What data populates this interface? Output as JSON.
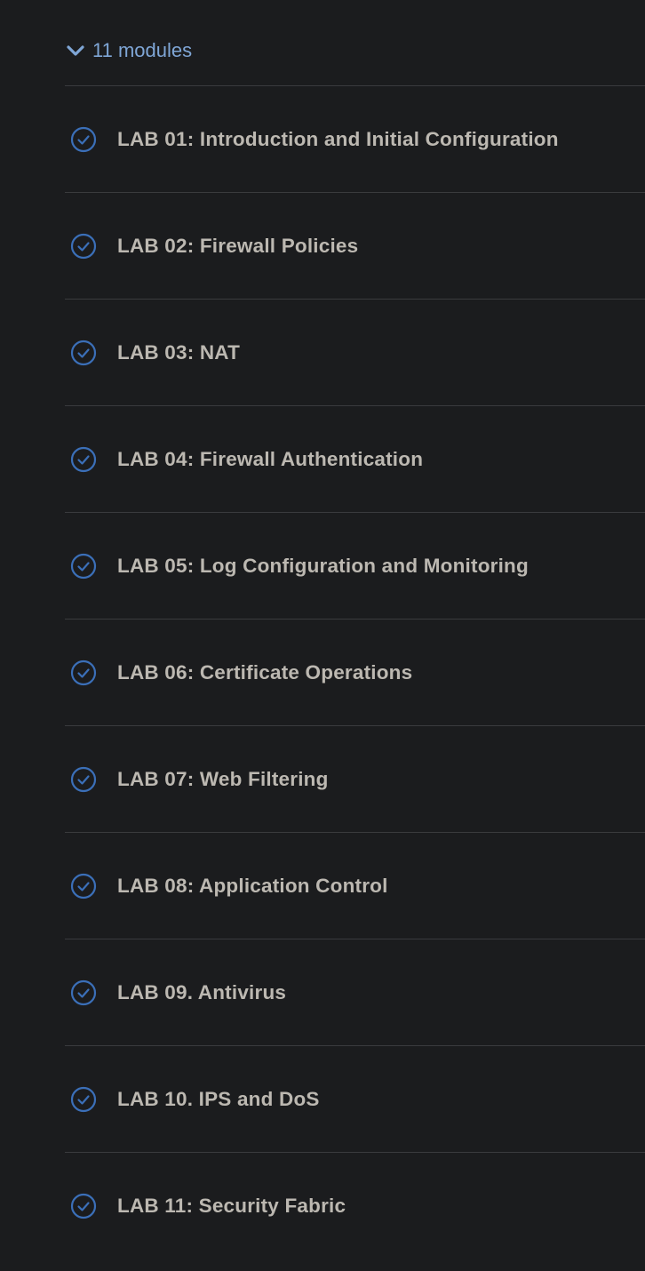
{
  "modules": {
    "count_label": "11 modules",
    "items": [
      {
        "title": "LAB 01: Introduction and Initial Configuration"
      },
      {
        "title": "LAB 02: Firewall Policies"
      },
      {
        "title": "LAB 03: NAT"
      },
      {
        "title": "LAB 04: Firewall Authentication"
      },
      {
        "title": "LAB 05: Log Configuration and Monitoring"
      },
      {
        "title": "LAB 06: Certificate Operations"
      },
      {
        "title": "LAB 07: Web Filtering"
      },
      {
        "title": "LAB 08: Application Control"
      },
      {
        "title": "LAB 09. Antivirus"
      },
      {
        "title": "LAB 10. IPS and DoS"
      },
      {
        "title": "LAB 11: Security Fabric"
      }
    ]
  },
  "icons": {
    "toggle": "chevron-down-icon",
    "completed": "check-circle-icon"
  },
  "colors": {
    "background": "#1b1c1e",
    "accent": "#7fa6d6",
    "check": "#3b6fb8",
    "title_text": "#bcb8b1",
    "divider": "#3a3b3e"
  }
}
